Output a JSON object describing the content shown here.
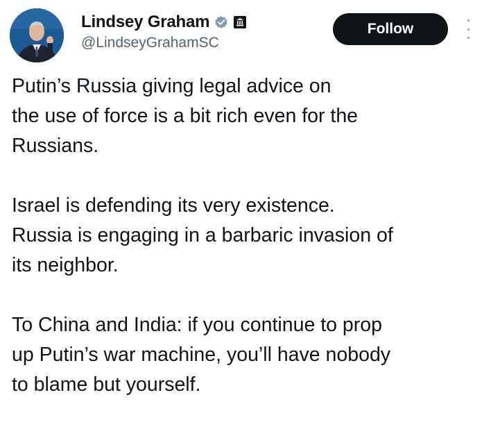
{
  "author": {
    "display_name": "Lindsey Graham",
    "handle": "@LindseyGrahamSC",
    "avatar_icon": "person-avatar",
    "verified_icon": "verified-badge-icon",
    "affiliation_icon": "government-badge-icon"
  },
  "actions": {
    "follow_label": "Follow",
    "more_icon": "vertical-ellipsis-icon"
  },
  "tweet": {
    "paragraphs": [
      "Putin’s Russia giving legal advice on\nthe use of force is a bit rich even for the\nRussians.",
      "Israel is defending its very existence.\nRussia is engaging in a barbaric invasion of\nits neighbor.",
      "To China and India: if you continue to prop\nup Putin’s war machine, you’ll have nobody\nto blame but yourself."
    ]
  },
  "colors": {
    "text": "#0f1419",
    "secondary_text": "#536471",
    "follow_button_bg": "#0f1419",
    "follow_button_text": "#ffffff",
    "verified_badge": "#829aab",
    "government_badge": "#0f1419"
  }
}
